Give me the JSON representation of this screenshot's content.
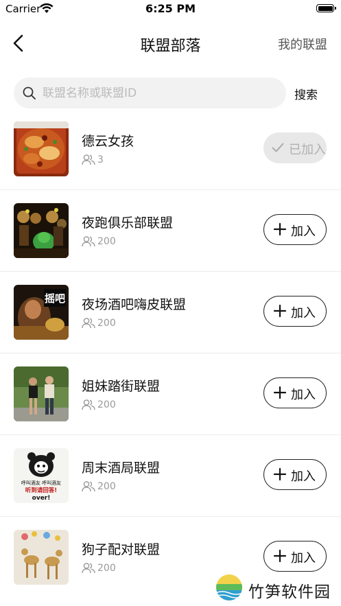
{
  "status_bar": {
    "carrier": "Carrier",
    "time": "6:25 PM"
  },
  "nav": {
    "back_icon": "chevron-left-icon",
    "title": "联盟部落",
    "right_link": "我的联盟"
  },
  "search": {
    "placeholder": "联盟名称或联盟ID",
    "value": "",
    "button": "搜索"
  },
  "alliances": [
    {
      "name": "德云女孩",
      "members": "3",
      "action": "已加入",
      "joined": true,
      "avatar": "spicy-food-photo"
    },
    {
      "name": "夜跑俱乐部联盟",
      "members": "200",
      "action": "加入",
      "joined": false,
      "avatar": "night-party-photo"
    },
    {
      "name": "夜场酒吧嗨皮联盟",
      "members": "200",
      "action": "加入",
      "joined": false,
      "avatar": "bar-poster-photo",
      "avatar_text": "摇吧"
    },
    {
      "name": "姐妹踏街联盟",
      "members": "200",
      "action": "加入",
      "joined": false,
      "avatar": "street-girls-photo"
    },
    {
      "name": "周末酒局联盟",
      "members": "200",
      "action": "加入",
      "joined": false,
      "avatar": "panda-meme",
      "avatar_text": {
        "line1": "呼叫酒友 呼叫酒友",
        "line2": "听到请回答!",
        "line3": "over!"
      }
    },
    {
      "name": "狗子配对联盟",
      "members": "200",
      "action": "加入",
      "joined": false,
      "avatar": "dogs-drawing"
    }
  ],
  "watermark": {
    "text": "竹笋软件园"
  },
  "colors": {
    "accent": "#111111",
    "muted": "#999999",
    "joined_bg": "#e8e8e8",
    "search_bg": "#f2f2f2"
  }
}
